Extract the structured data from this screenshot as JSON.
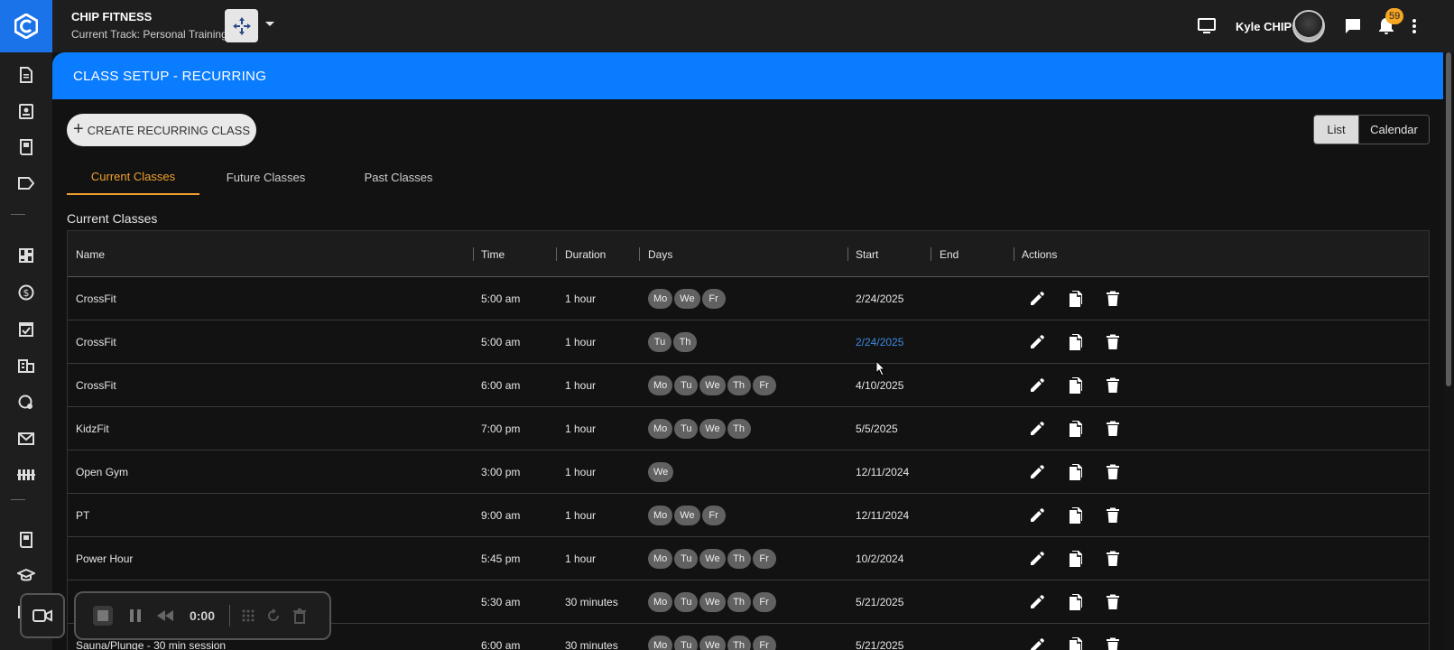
{
  "header": {
    "brand_name": "CHIP FITNESS",
    "current_track": "Current Track: Personal Training",
    "user_name": "Kyle CHIP",
    "notification_count": "59"
  },
  "sidebar": {
    "icons": [
      "document-icon",
      "contact-card-icon",
      "book-icon",
      "tag-icon",
      "dashboard-icon",
      "dollar-icon",
      "calendar-check-icon",
      "building-icon",
      "location-icon",
      "mail-icon",
      "equipment-icon",
      "book-icon",
      "graduation-cap-icon",
      "mail-icon"
    ]
  },
  "banner": {
    "title": "CLASS SETUP - RECURRING"
  },
  "toolbar": {
    "create_label": "CREATE RECURRING CLASS",
    "view_list": "List",
    "view_calendar": "Calendar"
  },
  "tabs": [
    {
      "label": "Current Classes",
      "active": true
    },
    {
      "label": "Future Classes",
      "active": false
    },
    {
      "label": "Past Classes",
      "active": false
    }
  ],
  "section_title": "Current Classes",
  "table": {
    "columns": [
      "Name",
      "Time",
      "Duration",
      "Days",
      "Start",
      "End",
      "Actions"
    ],
    "rows": [
      {
        "name": "CrossFit",
        "time": "5:00 am",
        "duration": "1 hour",
        "days": [
          "Mo",
          "We",
          "Fr"
        ],
        "start": "2/24/2025",
        "end": ""
      },
      {
        "name": "CrossFit",
        "time": "5:00 am",
        "duration": "1 hour",
        "days": [
          "Tu",
          "Th"
        ],
        "start": "2/24/2025",
        "end": ""
      },
      {
        "name": "CrossFit",
        "time": "6:00 am",
        "duration": "1 hour",
        "days": [
          "Mo",
          "Tu",
          "We",
          "Th",
          "Fr"
        ],
        "start": "4/10/2025",
        "end": ""
      },
      {
        "name": "KidzFit",
        "time": "7:00 pm",
        "duration": "1 hour",
        "days": [
          "Mo",
          "Tu",
          "We",
          "Th"
        ],
        "start": "5/5/2025",
        "end": ""
      },
      {
        "name": "Open Gym",
        "time": "3:00 pm",
        "duration": "1 hour",
        "days": [
          "We"
        ],
        "start": "12/11/2024",
        "end": ""
      },
      {
        "name": "PT",
        "time": "9:00 am",
        "duration": "1 hour",
        "days": [
          "Mo",
          "We",
          "Fr"
        ],
        "start": "12/11/2024",
        "end": ""
      },
      {
        "name": "Power Hour",
        "time": "5:45 pm",
        "duration": "1 hour",
        "days": [
          "Mo",
          "Tu",
          "We",
          "Th",
          "Fr"
        ],
        "start": "10/2/2024",
        "end": ""
      },
      {
        "name": "",
        "time": "5:30 am",
        "duration": "30 minutes",
        "days": [
          "Mo",
          "Tu",
          "We",
          "Th",
          "Fr"
        ],
        "start": "5/21/2025",
        "end": ""
      },
      {
        "name": "Sauna/Plunge - 30 min session",
        "time": "6:00 am",
        "duration": "30 minutes",
        "days": [
          "Mo",
          "Tu",
          "We",
          "Th",
          "Fr"
        ],
        "start": "5/21/2025",
        "end": ""
      }
    ]
  },
  "recorder": {
    "time": "0:00"
  },
  "colors": {
    "accent": "#0a7cff",
    "tab_active": "#f0a030",
    "badge": "#f5a623",
    "link": "#3d8bdf"
  }
}
